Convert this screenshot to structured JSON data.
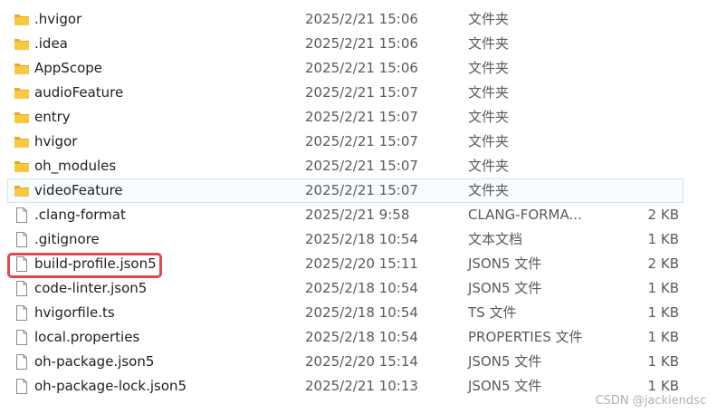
{
  "file_list": {
    "items": [
      {
        "name": ".hvigor",
        "date": "2025/2/21 15:06",
        "type": "文件夹",
        "size": "",
        "icon": "folder-icon"
      },
      {
        "name": ".idea",
        "date": "2025/2/21 15:06",
        "type": "文件夹",
        "size": "",
        "icon": "folder-icon"
      },
      {
        "name": "AppScope",
        "date": "2025/2/21 15:06",
        "type": "文件夹",
        "size": "",
        "icon": "folder-icon"
      },
      {
        "name": "audioFeature",
        "date": "2025/2/21 15:07",
        "type": "文件夹",
        "size": "",
        "icon": "folder-icon"
      },
      {
        "name": "entry",
        "date": "2025/2/21 15:07",
        "type": "文件夹",
        "size": "",
        "icon": "folder-icon"
      },
      {
        "name": "hvigor",
        "date": "2025/2/21 15:07",
        "type": "文件夹",
        "size": "",
        "icon": "folder-icon"
      },
      {
        "name": "oh_modules",
        "date": "2025/2/21 15:07",
        "type": "文件夹",
        "size": "",
        "icon": "folder-icon"
      },
      {
        "name": "videoFeature",
        "date": "2025/2/21 15:07",
        "type": "文件夹",
        "size": "",
        "icon": "folder-icon",
        "hover": true
      },
      {
        "name": ".clang-format",
        "date": "2025/2/21 9:58",
        "type": "CLANG-FORMA...",
        "size": "2 KB",
        "icon": "file-icon"
      },
      {
        "name": ".gitignore",
        "date": "2025/2/18 10:54",
        "type": "文本文档",
        "size": "1 KB",
        "icon": "file-icon"
      },
      {
        "name": "build-profile.json5",
        "date": "2025/2/20 15:11",
        "type": "JSON5 文件",
        "size": "2 KB",
        "icon": "file-icon",
        "highlighted": true
      },
      {
        "name": "code-linter.json5",
        "date": "2025/2/18 10:54",
        "type": "JSON5 文件",
        "size": "1 KB",
        "icon": "file-icon"
      },
      {
        "name": "hvigorfile.ts",
        "date": "2025/2/18 10:54",
        "type": "TS 文件",
        "size": "1 KB",
        "icon": "file-icon"
      },
      {
        "name": "local.properties",
        "date": "2025/2/18 10:54",
        "type": "PROPERTIES 文件",
        "size": "1 KB",
        "icon": "file-icon"
      },
      {
        "name": "oh-package.json5",
        "date": "2025/2/20 15:14",
        "type": "JSON5 文件",
        "size": "1 KB",
        "icon": "file-icon"
      },
      {
        "name": "oh-package-lock.json5",
        "date": "2025/2/21 10:13",
        "type": "JSON5 文件",
        "size": "1 KB",
        "icon": "file-icon"
      }
    ]
  },
  "colors": {
    "folder": "#f8c93f",
    "folder_dark": "#e3a92a",
    "highlight_border": "#e5474f",
    "hover_border": "#cfe3ee"
  },
  "watermark": "CSDN @jackiendsc"
}
